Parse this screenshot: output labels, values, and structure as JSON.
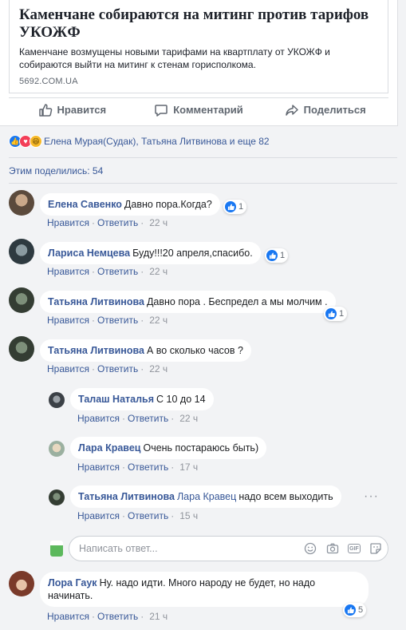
{
  "post": {
    "link_title": "Каменчане собираются на митинг против тарифов УКОЖФ",
    "link_description": "Каменчане возмущены новыми тарифами на квартплату от УКОЖФ и собираются выйти на митинг к стенам горисполкома.",
    "link_domain": "5692.COM.UA",
    "actions": {
      "like": "Нравится",
      "comment": "Комментарий",
      "share": "Поделиться"
    },
    "reactions_text": "Елена Мурая(Судак), Татьяна Литвинова и еще 82",
    "shares_text": "Этим поделились: 54"
  },
  "comments": [
    {
      "author": "Елена Савенко",
      "text": "Давно пора.Когда?",
      "like": "Нравится",
      "reply": "Ответить",
      "time": "22 ч",
      "likes": "1"
    },
    {
      "author": "Лариса Немцева",
      "text": "Буду!!!20 апреля,спасибо.",
      "like": "Нравится",
      "reply": "Ответить",
      "time": "22 ч",
      "likes": "1"
    },
    {
      "author": "Татьяна Литвинова",
      "text": "Давно пора . Беспредел а мы молчим .",
      "like": "Нравится",
      "reply": "Ответить",
      "time": "22 ч",
      "likes": "1"
    },
    {
      "author": "Татьяна Литвинова",
      "text": "А во сколько часов ?",
      "like": "Нравится",
      "reply": "Ответить",
      "time": "22 ч"
    },
    {
      "author": "Лора Гаук",
      "text_line1": "Ну. надо идти. Много народу не будет, но надо",
      "text_line2": "начинать.",
      "like": "Нравится",
      "reply": "Ответить",
      "time": "21 ч",
      "likes": "5"
    }
  ],
  "replies": [
    {
      "author": "Талаш Наталья",
      "text": "С 10 до 14",
      "like": "Нравится",
      "reply": "Ответить",
      "time": "22 ч"
    },
    {
      "author": "Лара Кравец",
      "text": "Очень постараюсь быть)",
      "like": "Нравится",
      "reply": "Ответить",
      "time": "17 ч"
    },
    {
      "author": "Татьяна Литвинова",
      "mention": "Лара Кравец",
      "text": "надо всем выходить",
      "like": "Нравится",
      "reply": "Ответить",
      "time": "15 ч"
    }
  ],
  "reply_box": {
    "placeholder": "Написать ответ..."
  },
  "colors": {
    "link": "#385898",
    "like_blue": "#1877f2",
    "muted": "#90949c",
    "bg": "#f2f3f5"
  }
}
